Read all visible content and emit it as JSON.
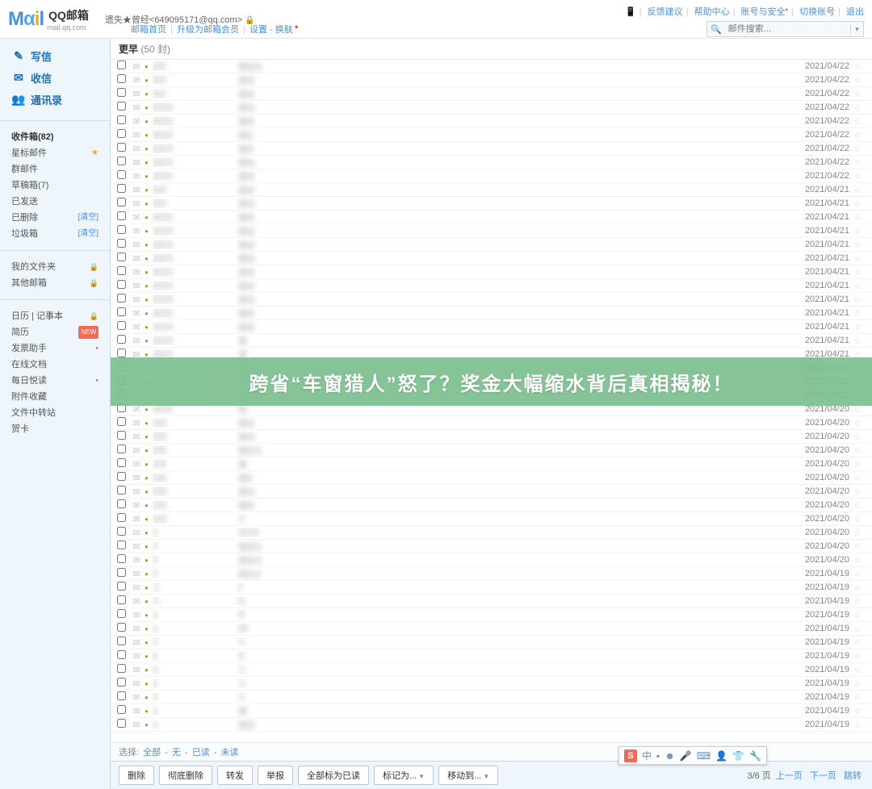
{
  "header": {
    "logo_text": "MAIL",
    "logo_brand": "QQ邮箱",
    "logo_domain": "mail.qq.com",
    "user_display": "遗失★曾经<649095171@qq.com>",
    "sub_links": [
      "邮箱首页",
      "升级为邮箱会员",
      "设置 - 换肤"
    ],
    "top_links": [
      "反馈建议",
      "帮助中心",
      "账号与安全",
      "切换账号",
      "退出"
    ],
    "search_placeholder": "邮件搜索..."
  },
  "sidebar": {
    "actions": [
      {
        "icon": "✎",
        "label": "写信"
      },
      {
        "icon": "✉",
        "label": "收信"
      },
      {
        "icon": "👥",
        "label": "通讯录"
      }
    ],
    "folders1": [
      {
        "label": "收件箱(82)",
        "bold": true
      },
      {
        "label": "星标邮件",
        "star": true
      },
      {
        "label": "群邮件"
      },
      {
        "label": "草稿箱(7)"
      },
      {
        "label": "已发送"
      },
      {
        "label": "已删除",
        "clear": "[清空]"
      },
      {
        "label": "垃圾箱",
        "clear": "[清空]"
      }
    ],
    "folders2": [
      {
        "label": "我的文件夹",
        "lock": true
      },
      {
        "label": "其他邮箱",
        "lock": true
      }
    ],
    "folders3": [
      {
        "label": "日历 | 记事本",
        "lock": true
      },
      {
        "label": "简历",
        "badge": "NEW"
      },
      {
        "label": "发票助手",
        "dot": true
      },
      {
        "label": "在线文档"
      },
      {
        "label": "每日悦读",
        "dot": true
      },
      {
        "label": "附件收藏"
      },
      {
        "label": "文件中转站"
      },
      {
        "label": "贺卡"
      }
    ]
  },
  "content": {
    "group_label": "更早",
    "group_count": "(50 封)",
    "rows": [
      {
        "sender": "ycc",
        "subj": "晋M    8",
        "date": "2021/04/22"
      },
      {
        "sender": "ycc",
        "subj": "晋M",
        "date": "2021/04/22"
      },
      {
        "sender": "ycc",
        "subj": "晋M",
        "date": "2021/04/22"
      },
      {
        "sender": "ycc   s",
        "subj": "晋M",
        "date": "2021/04/22"
      },
      {
        "sender": "ycc   s",
        "subj": "晋M",
        "date": "2021/04/22"
      },
      {
        "sender": "ycc   s",
        "subj": "陕A",
        "date": "2021/04/22"
      },
      {
        "sender": "ycc   s",
        "subj": "晋H",
        "date": "2021/04/22"
      },
      {
        "sender": "ycc   s",
        "subj": "晋M",
        "date": "2021/04/22"
      },
      {
        "sender": "ycc   s",
        "subj": "晋M",
        "date": "2021/04/22"
      },
      {
        "sender": "ycc",
        "subj": "晋M",
        "date": "2021/04/21"
      },
      {
        "sender": "ycc",
        "subj": "晋M",
        "date": "2021/04/21"
      },
      {
        "sender": "ycc   s",
        "subj": "晋M",
        "date": "2021/04/21"
      },
      {
        "sender": "ycc   s",
        "subj": "晋M",
        "date": "2021/04/21"
      },
      {
        "sender": "ycc   s",
        "subj": "晋M",
        "date": "2021/04/21"
      },
      {
        "sender": "ycc   s",
        "subj": "晋M",
        "date": "2021/04/21"
      },
      {
        "sender": "ycc   s",
        "subj": "晋M",
        "date": "2021/04/21"
      },
      {
        "sender": "ycc   s",
        "subj": "晋M",
        "date": "2021/04/21"
      },
      {
        "sender": "ycc   s",
        "subj": "晋M",
        "date": "2021/04/21"
      },
      {
        "sender": "ycc   s",
        "subj": "晋M",
        "date": "2021/04/21"
      },
      {
        "sender": "ycc   s",
        "subj": "晋M",
        "date": "2021/04/21"
      },
      {
        "sender": "ycc   s",
        "subj": "豫",
        "date": "2021/04/21"
      },
      {
        "sender": "ycc   s",
        "subj": "晋",
        "date": "2021/04/21"
      },
      {
        "sender": "ycc   s",
        "subj": "晋",
        "date": "2021/04/21"
      },
      {
        "sender": "ycc   s",
        "subj": "晋",
        "date": "2021/04/21"
      },
      {
        "sender": "ycc   s",
        "subj": "晋",
        "date": "2021/04/21"
      },
      {
        "sender": "ycc   s",
        "subj": "晋",
        "date": "2021/04/20"
      },
      {
        "sender": "y     ts",
        "subj": "晋M",
        "date": "2021/04/20"
      },
      {
        "sender": "y     ts",
        "subj": "晋M",
        "date": "2021/04/20"
      },
      {
        "sender": "y     ts",
        "subj": "晋M   7",
        "date": "2021/04/20"
      },
      {
        "sender": "y     ts",
        "subj": "豫",
        "date": "2021/04/20"
      },
      {
        "sender": "y     ts",
        "subj": "晋A",
        "date": "2021/04/20"
      },
      {
        "sender": "y     ts",
        "subj": "晋M",
        "date": "2021/04/20"
      },
      {
        "sender": "y     ts",
        "subj": "晋M",
        "date": "2021/04/20"
      },
      {
        "sender": "y     ts",
        "subj": "",
        "date": "2021/04/20"
      },
      {
        "sender": "        s",
        "subj": "JIY   5",
        "date": "2021/04/20"
      },
      {
        "sender": "        s",
        "subj": "晋M   L",
        "date": "2021/04/20"
      },
      {
        "sender": "        s",
        "subj": "晋M   7",
        "date": "2021/04/20"
      },
      {
        "sender": "        s",
        "subj": "陕A   V",
        "date": "2021/04/19"
      },
      {
        "sender": "",
        "subj": "      7",
        "date": "2021/04/19"
      },
      {
        "sender": "",
        "subj": "      H",
        "date": "2021/04/19"
      },
      {
        "sender": "y",
        "subj": "      D",
        "date": "2021/04/19"
      },
      {
        "sender": "y",
        "subj": "      95",
        "date": "2021/04/19"
      },
      {
        "sender": "y",
        "subj": "",
        "date": "2021/04/19"
      },
      {
        "sender": "y",
        "subj": "      C",
        "date": "2021/04/19"
      },
      {
        "sender": "y",
        "subj": "",
        "date": "2021/04/19"
      },
      {
        "sender": "y",
        "subj": "",
        "date": "2021/04/19"
      },
      {
        "sender": "y",
        "subj": "",
        "date": "2021/04/19"
      },
      {
        "sender": "y",
        "subj": "晋",
        "date": "2021/04/19"
      },
      {
        "sender": "y",
        "subj": "晋M",
        "date": "2021/04/19"
      }
    ],
    "overlay_text": "跨省“车窗猎人”怒了？奖金大幅缩水背后真相揭秘！",
    "select_label": "选择:",
    "select_opts": [
      "全部",
      "无",
      "已读",
      "未读"
    ],
    "toolbar_btns": [
      "删除",
      "彻底删除",
      "转发",
      "举报",
      "全部标为已读",
      "标记为...",
      "移动到..."
    ],
    "page_info": "3/6 页",
    "page_nav": [
      "上一页",
      "下一页",
      "跳转"
    ]
  },
  "ime": {
    "zhong": "中"
  }
}
